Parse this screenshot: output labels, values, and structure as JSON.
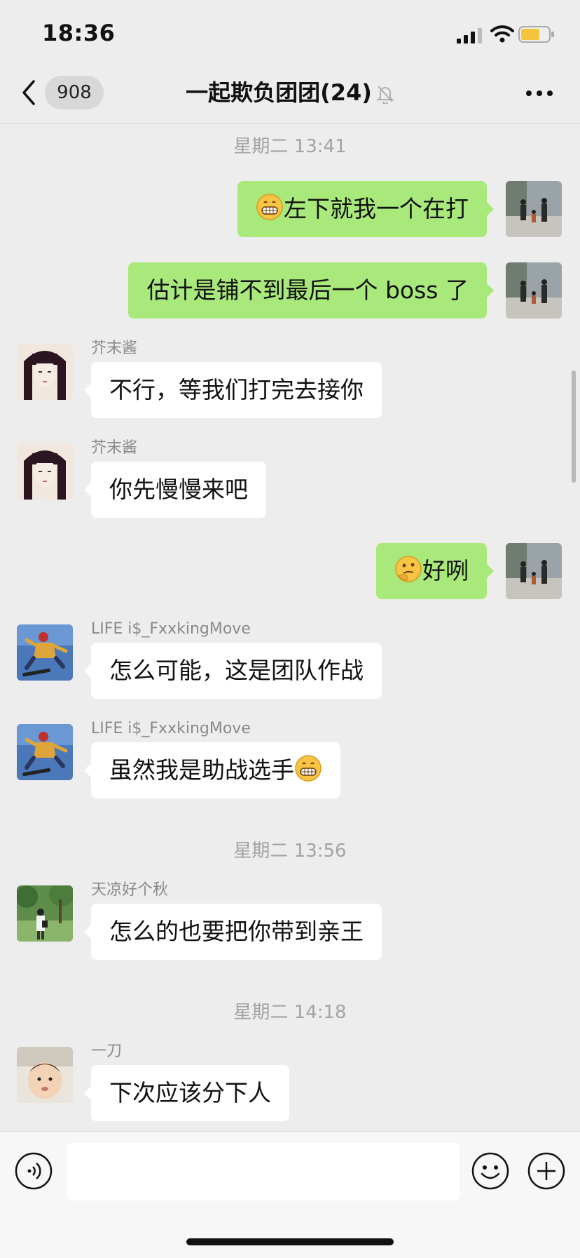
{
  "status_bar": {
    "time": "18:36"
  },
  "nav": {
    "unread_count": "908",
    "title": "一起欺负团团(24)"
  },
  "timestamps": [
    "星期二 13:41",
    "星期二 13:56",
    "星期二 14:18"
  ],
  "messages": [
    {
      "direction": "out",
      "text": "左下就我一个在打",
      "emoji_before": "grin-emoji"
    },
    {
      "direction": "out",
      "text": "估计是铺不到最后一个 boss 了"
    },
    {
      "direction": "in",
      "sender": "芥末酱",
      "text": "不行，等我们打完去接你"
    },
    {
      "direction": "in",
      "sender": "芥末酱",
      "text": "你先慢慢来吧"
    },
    {
      "direction": "out",
      "text": "好咧",
      "emoji_before": "thinking-emoji"
    },
    {
      "direction": "in",
      "sender": "LIFE i$_FxxkingMove",
      "text": "怎么可能，这是团队作战"
    },
    {
      "direction": "in",
      "sender": "LIFE i$_FxxkingMove",
      "text": "虽然我是助战选手",
      "emoji_after": "grin-emoji"
    },
    {
      "direction": "in",
      "sender": "天凉好个秋",
      "text": "怎么的也要把你带到亲王"
    },
    {
      "direction": "in",
      "sender": "一刀",
      "text": "下次应该分下人"
    }
  ],
  "input_bar": {
    "value": ""
  },
  "colors": {
    "bg": "#ededed",
    "bubble_out": "#a9e87a",
    "bubble_in": "#ffffff",
    "battery": "#f5c43a"
  }
}
